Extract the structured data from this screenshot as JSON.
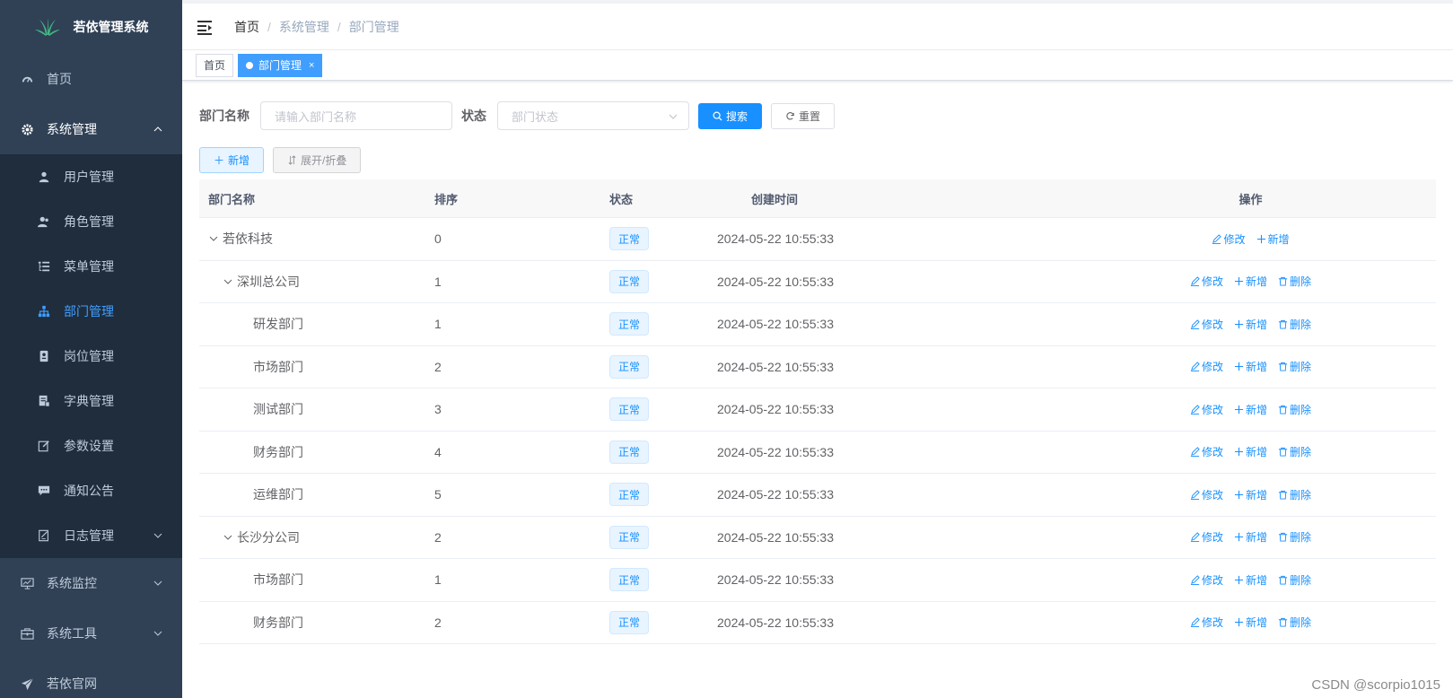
{
  "app": {
    "title": "若依管理系统"
  },
  "sidebar": {
    "items": [
      {
        "label": "首页",
        "icon": "dashboard-icon"
      },
      {
        "label": "系统管理",
        "icon": "gear-icon",
        "open": true,
        "children": [
          {
            "label": "用户管理",
            "icon": "user-icon"
          },
          {
            "label": "角色管理",
            "icon": "peoples-icon"
          },
          {
            "label": "菜单管理",
            "icon": "tree-table-icon"
          },
          {
            "label": "部门管理",
            "icon": "tree-icon",
            "active": true
          },
          {
            "label": "岗位管理",
            "icon": "post-icon"
          },
          {
            "label": "字典管理",
            "icon": "dict-icon"
          },
          {
            "label": "参数设置",
            "icon": "edit-icon"
          },
          {
            "label": "通知公告",
            "icon": "message-icon"
          },
          {
            "label": "日志管理",
            "icon": "log-icon"
          }
        ]
      },
      {
        "label": "系统监控",
        "icon": "monitor-icon"
      },
      {
        "label": "系统工具",
        "icon": "tool-icon"
      },
      {
        "label": "若依官网",
        "icon": "guide-icon"
      }
    ]
  },
  "breadcrumb": [
    "首页",
    "系统管理",
    "部门管理"
  ],
  "tags": [
    {
      "label": "首页",
      "active": false
    },
    {
      "label": "部门管理",
      "active": true,
      "close": "×"
    }
  ],
  "search": {
    "dept_label": "部门名称",
    "dept_placeholder": "请输入部门名称",
    "status_label": "状态",
    "status_placeholder": "部门状态",
    "search_btn": "搜索",
    "reset_btn": "重置"
  },
  "toolbar": {
    "add_btn": "新增",
    "expand_btn": "展开/折叠"
  },
  "table": {
    "headers": {
      "name": "部门名称",
      "sort": "排序",
      "status": "状态",
      "time": "创建时间",
      "ops": "操作"
    },
    "ops": {
      "edit": "修改",
      "add": "新增",
      "delete": "删除"
    },
    "rows": [
      {
        "name": "若依科技",
        "level": 0,
        "expand": true,
        "sort": "0",
        "status": "正常",
        "time": "2024-05-22 10:55:33",
        "deletable": false
      },
      {
        "name": "深圳总公司",
        "level": 1,
        "expand": true,
        "sort": "1",
        "status": "正常",
        "time": "2024-05-22 10:55:33",
        "deletable": true
      },
      {
        "name": "研发部门",
        "level": 2,
        "expand": false,
        "sort": "1",
        "status": "正常",
        "time": "2024-05-22 10:55:33",
        "deletable": true
      },
      {
        "name": "市场部门",
        "level": 2,
        "expand": false,
        "sort": "2",
        "status": "正常",
        "time": "2024-05-22 10:55:33",
        "deletable": true
      },
      {
        "name": "测试部门",
        "level": 2,
        "expand": false,
        "sort": "3",
        "status": "正常",
        "time": "2024-05-22 10:55:33",
        "deletable": true
      },
      {
        "name": "财务部门",
        "level": 2,
        "expand": false,
        "sort": "4",
        "status": "正常",
        "time": "2024-05-22 10:55:33",
        "deletable": true
      },
      {
        "name": "运维部门",
        "level": 2,
        "expand": false,
        "sort": "5",
        "status": "正常",
        "time": "2024-05-22 10:55:33",
        "deletable": true
      },
      {
        "name": "长沙分公司",
        "level": 1,
        "expand": true,
        "sort": "2",
        "status": "正常",
        "time": "2024-05-22 10:55:33",
        "deletable": true
      },
      {
        "name": "市场部门",
        "level": 2,
        "expand": false,
        "sort": "1",
        "status": "正常",
        "time": "2024-05-22 10:55:33",
        "deletable": true
      },
      {
        "name": "财务部门",
        "level": 2,
        "expand": false,
        "sort": "2",
        "status": "正常",
        "time": "2024-05-22 10:55:33",
        "deletable": true
      }
    ]
  },
  "watermark": "CSDN @scorpio1015",
  "colors": {
    "sidebar_bg": "#304156",
    "submenu_bg": "#1f2d3d",
    "primary": "#1890ff",
    "active_menu": "#409eff"
  }
}
